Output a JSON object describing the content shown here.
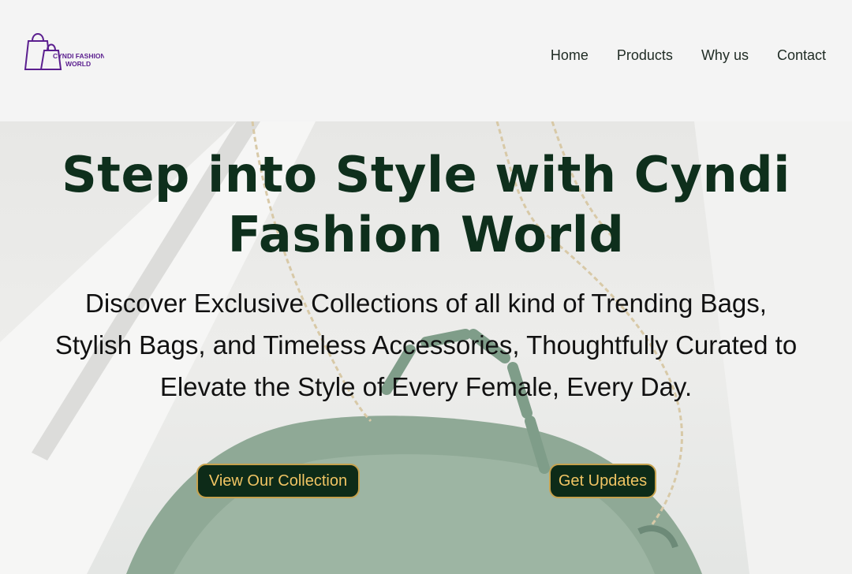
{
  "logo": {
    "line1": "CYNDI FASHION",
    "line2": "WORLD",
    "icon": "shopping-bags-icon",
    "color": "#5b1f8f"
  },
  "nav": {
    "items": [
      {
        "label": "Home"
      },
      {
        "label": "Products"
      },
      {
        "label": "Why us"
      },
      {
        "label": "Contact"
      }
    ]
  },
  "hero": {
    "title_line1": "Step into Style with Cyndi",
    "title_line2": "Fashion World",
    "subtitle_line1": "Discover Exclusive Collections of all kind of Trending Bags,",
    "subtitle_line2": "Stylish Bags, and Timeless Accessories, Thoughtfully Curated to",
    "subtitle_line3": "Elevate the Style of Every Female, Every Day.",
    "buttons": {
      "collection": "View Our Collection",
      "updates": "Get Updates"
    },
    "image": "green-woven-bag-with-chain-photo"
  },
  "colors": {
    "title": "#0e2f1c",
    "button_bg": "#0d2b18",
    "button_text": "#f0c463",
    "button_border": "#c6a24e"
  }
}
